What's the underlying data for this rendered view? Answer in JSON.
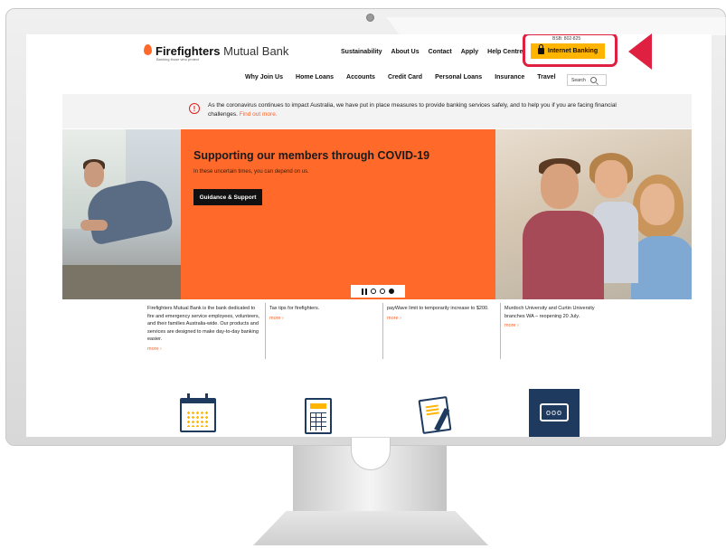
{
  "header": {
    "logo_bold": "Firefighters",
    "logo_light": "Mutual Bank",
    "logo_tagline": "Banking those who protect",
    "bsb": "BSB: 802-825",
    "internet_banking_label": "Internet Banking"
  },
  "top_nav": [
    "Sustainability",
    "About Us",
    "Contact",
    "Apply",
    "Help Centre"
  ],
  "main_nav": [
    "Why Join Us",
    "Home Loans",
    "Accounts",
    "Credit Card",
    "Personal Loans",
    "Insurance",
    "Travel"
  ],
  "search": {
    "label": "Search"
  },
  "alert": {
    "text": "As the coronavirus continues to impact Australia, we have put in place measures to provide banking services safely, and to help you if you are facing financial challenges.",
    "link": "Find out more."
  },
  "hero": {
    "title": "Supporting our members through COVID-19",
    "subtitle": "In these uncertain times, you can depend on us.",
    "button_label": "Guidance & Support"
  },
  "news": [
    {
      "text": "Firefighters Mutual Bank is the bank dedicated to fire and emergency service employees, volunteers, and their families Australia-wide. Our products and services are designed to make day-to-day banking easier.",
      "more": "more ›"
    },
    {
      "text": "Tax tips for firefighters.",
      "more": "more ›"
    },
    {
      "text": "payWave limit to temporarily increase to $200.",
      "more": "more ›"
    },
    {
      "text": "Murdoch University and Curtin University branches WA – reopening 20 July.",
      "more": "more ›"
    }
  ],
  "icons": [
    "calendar-icon",
    "calculator-icon",
    "form-icon",
    "chat-icon"
  ],
  "colors": {
    "accent": "#ff6a2b",
    "button": "#ffb400",
    "navy": "#1e3a5f",
    "highlight": "#e02040"
  }
}
